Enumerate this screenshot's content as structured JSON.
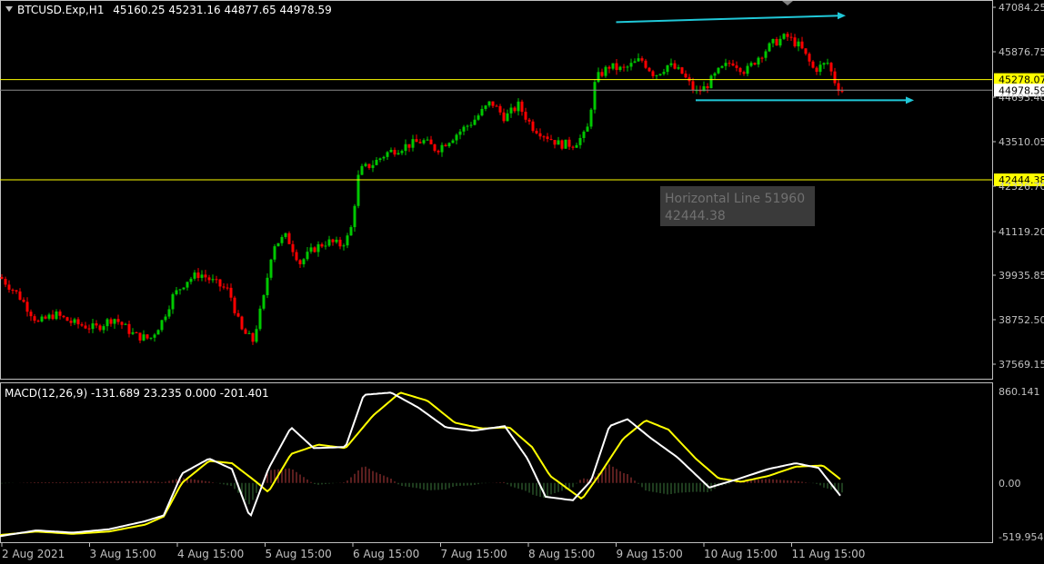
{
  "header": {
    "symbol": "BTCUSD.Exp,H1",
    "ohlc": "45160.25 45231.16 44877.65 44978.59"
  },
  "indicator_label": "MACD(12,26,9) -131.689 23.235 0.000 -201.401",
  "tooltip": {
    "line1": "Horizontal Line 51960",
    "line2": "42444.38"
  },
  "colors": {
    "background": "#000000",
    "bull_candle": "#00c800",
    "bear_candle": "#ff0000",
    "hline": "#ffff00",
    "bid_line": "#8c8c8c",
    "trend_arrow": "#20c8d8",
    "macd_line": "#ffffff",
    "signal_line": "#ffff00",
    "hist_pos": "#b43c3c",
    "hist_neg": "#3c783c",
    "axis_text": "#c0c0c0"
  },
  "chart_data": [
    {
      "type": "candlestick",
      "title": "BTCUSD.Exp,H1",
      "ylim": [
        36800,
        47500
      ],
      "y_ticks": [
        "47084.25",
        "45876.75",
        "44693.40",
        "43510.05",
        "42326.70",
        "41119.20",
        "39935.85",
        "38752.50",
        "37569.15"
      ],
      "x_ticks": [
        "2 Aug 2021",
        "3 Aug 15:00",
        "4 Aug 15:00",
        "5 Aug 15:00",
        "6 Aug 15:00",
        "7 Aug 15:00",
        "8 Aug 15:00",
        "9 Aug 15:00",
        "10 Aug 15:00",
        "11 Aug 15:00"
      ],
      "close_path": [
        [
          0,
          39700
        ],
        [
          20,
          39200
        ],
        [
          42,
          38400
        ],
        [
          60,
          38650
        ],
        [
          80,
          38400
        ],
        [
          105,
          38250
        ],
        [
          125,
          38550
        ],
        [
          148,
          38050
        ],
        [
          165,
          37950
        ],
        [
          178,
          38450
        ],
        [
          190,
          39150
        ],
        [
          205,
          39600
        ],
        [
          220,
          39800
        ],
        [
          235,
          39550
        ],
        [
          252,
          39300
        ],
        [
          265,
          38200
        ],
        [
          278,
          37900
        ],
        [
          290,
          39100
        ],
        [
          300,
          40600
        ],
        [
          315,
          40850
        ],
        [
          330,
          40100
        ],
        [
          345,
          40500
        ],
        [
          360,
          40700
        ],
        [
          375,
          40600
        ],
        [
          385,
          40900
        ],
        [
          395,
          42700
        ],
        [
          410,
          42900
        ],
        [
          425,
          43200
        ],
        [
          445,
          43400
        ],
        [
          465,
          43550
        ],
        [
          480,
          43300
        ],
        [
          500,
          43700
        ],
        [
          520,
          44100
        ],
        [
          540,
          44650
        ],
        [
          555,
          44200
        ],
        [
          570,
          44550
        ],
        [
          585,
          43950
        ],
        [
          600,
          43700
        ],
        [
          615,
          43450
        ],
        [
          630,
          43450
        ],
        [
          645,
          43750
        ],
        [
          655,
          45300
        ],
        [
          670,
          45650
        ],
        [
          685,
          45550
        ],
        [
          705,
          45850
        ],
        [
          720,
          45400
        ],
        [
          735,
          45700
        ],
        [
          750,
          45450
        ],
        [
          765,
          44900
        ],
        [
          775,
          45050
        ],
        [
          790,
          45500
        ],
        [
          805,
          45800
        ],
        [
          820,
          45500
        ],
        [
          835,
          45950
        ],
        [
          850,
          46300
        ],
        [
          865,
          46500
        ],
        [
          880,
          46200
        ],
        [
          895,
          45550
        ],
        [
          910,
          45750
        ],
        [
          920,
          45100
        ],
        [
          926,
          44978.59
        ]
      ],
      "horizontal_lines": [
        45278.07,
        42444.38
      ],
      "bid_line": 44978.59,
      "bid_label": "44978.59",
      "hline_labels": [
        "45278.07",
        "42444.38"
      ],
      "trend_lines": [
        {
          "from": [
            "9 Aug 15:00",
            46900
          ],
          "to": [
            "11 Aug 21:00",
            47084.25
          ]
        },
        {
          "from": [
            "10 Aug 12:00",
            44693.4
          ],
          "to": [
            "13 Aug 00:00",
            44693.4
          ]
        }
      ]
    },
    {
      "type": "line",
      "title": "MACD(12,26,9)",
      "ylim": [
        -519.954,
        860.141
      ],
      "y_ticks": [
        "860.141",
        "0.00",
        "-519.954"
      ],
      "series": [
        {
          "name": "MACD",
          "values_path": [
            [
              0,
              -460
            ],
            [
              40,
              -410
            ],
            [
              80,
              -430
            ],
            [
              120,
              -400
            ],
            [
              160,
              -330
            ],
            [
              180,
              -280
            ],
            [
              200,
              80
            ],
            [
              230,
              210
            ],
            [
              255,
              120
            ],
            [
              275,
              -300
            ],
            [
              295,
              120
            ],
            [
              320,
              480
            ],
            [
              345,
              300
            ],
            [
              380,
              310
            ],
            [
              400,
              760
            ],
            [
              430,
              780
            ],
            [
              460,
              650
            ],
            [
              490,
              480
            ],
            [
              520,
              450
            ],
            [
              555,
              490
            ],
            [
              580,
              210
            ],
            [
              600,
              -120
            ],
            [
              630,
              -150
            ],
            [
              650,
              20
            ],
            [
              670,
              490
            ],
            [
              690,
              550
            ],
            [
              715,
              390
            ],
            [
              745,
              220
            ],
            [
              780,
              -40
            ],
            [
              810,
              30
            ],
            [
              845,
              120
            ],
            [
              875,
              170
            ],
            [
              900,
              130
            ],
            [
              926,
              -130
            ]
          ]
        },
        {
          "name": "Signal",
          "values_path": [
            [
              0,
              -450
            ],
            [
              40,
              -420
            ],
            [
              80,
              -440
            ],
            [
              120,
              -420
            ],
            [
              160,
              -360
            ],
            [
              180,
              -290
            ],
            [
              200,
              0
            ],
            [
              230,
              190
            ],
            [
              255,
              170
            ],
            [
              280,
              20
            ],
            [
              295,
              -80
            ],
            [
              320,
              250
            ],
            [
              350,
              330
            ],
            [
              380,
              300
            ],
            [
              410,
              580
            ],
            [
              440,
              780
            ],
            [
              470,
              710
            ],
            [
              500,
              520
            ],
            [
              530,
              470
            ],
            [
              560,
              480
            ],
            [
              585,
              310
            ],
            [
              605,
              60
            ],
            [
              640,
              -140
            ],
            [
              660,
              80
            ],
            [
              685,
              380
            ],
            [
              710,
              540
            ],
            [
              735,
              460
            ],
            [
              765,
              210
            ],
            [
              790,
              40
            ],
            [
              815,
              10
            ],
            [
              845,
              60
            ],
            [
              875,
              140
            ],
            [
              905,
              150
            ],
            [
              926,
              20
            ]
          ]
        }
      ],
      "histogram_note": "positive red bars, negative green bars around 0.00"
    }
  ]
}
